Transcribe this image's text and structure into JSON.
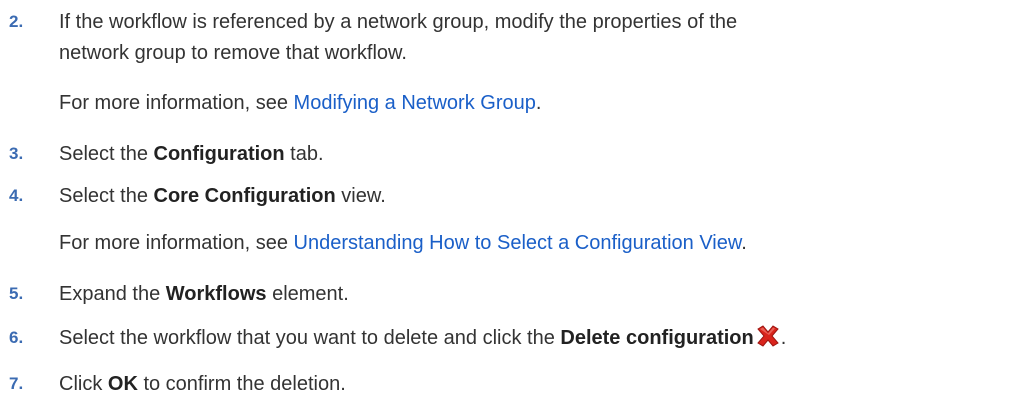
{
  "steps": [
    {
      "number": "2.",
      "line1": "If the workflow is referenced by a network group, modify the properties of the",
      "line2": "network group to remove that workflow.",
      "more_prefix": "For more information, see ",
      "more_link": "Modifying a Network Group",
      "more_suffix": "."
    },
    {
      "number": "3.",
      "pre": "Select the ",
      "bold": "Configuration",
      "post": " tab."
    },
    {
      "number": "4.",
      "pre": "Select the ",
      "bold": "Core Configuration",
      "post": " view.",
      "more_prefix": "For more information, see ",
      "more_link": "Understanding How to Select a Configuration View",
      "more_suffix": "."
    },
    {
      "number": "5.",
      "pre": "Expand the ",
      "bold": "Workflows",
      "post": " element."
    },
    {
      "number": "6.",
      "pre": "Select the workflow that you want to delete and click the ",
      "bold": "Delete configuration",
      "icon": "delete-x-icon",
      "post": "."
    },
    {
      "number": "7.",
      "pre": "Click ",
      "bold": "OK",
      "post": " to confirm the deletion."
    }
  ],
  "colors": {
    "step_number": "#3b6bb2",
    "link": "#1a5fc8",
    "delete_icon": "#d9241c"
  }
}
